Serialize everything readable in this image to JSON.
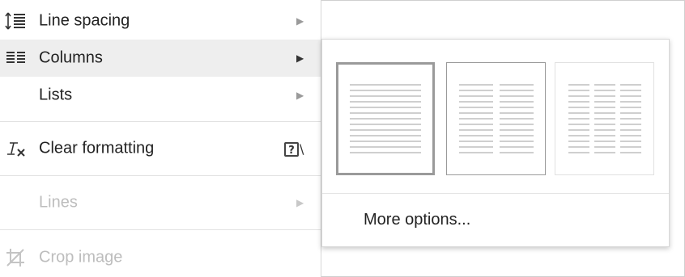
{
  "menu": {
    "line_spacing": {
      "label": "Line spacing",
      "icon": "line-spacing-icon"
    },
    "columns": {
      "label": "Columns",
      "icon": "columns-icon"
    },
    "lists": {
      "label": "Lists"
    },
    "clear_formatting": {
      "label": "Clear formatting",
      "icon": "clear-formatting-icon",
      "shortcut_key": "?",
      "shortcut_suffix": "\\"
    },
    "lines": {
      "label": "Lines",
      "disabled": true
    },
    "crop_image": {
      "label": "Crop image",
      "icon": "crop-icon",
      "disabled": true
    },
    "submenu_arrow": "▶"
  },
  "columns_submenu": {
    "options": [
      {
        "name": "one-column",
        "columns": 1,
        "selected": true
      },
      {
        "name": "two-columns",
        "columns": 2,
        "selected": false
      },
      {
        "name": "three-columns",
        "columns": 3,
        "selected": false
      }
    ],
    "more_options": "More options..."
  },
  "colors": {
    "highlight": "#eeeeee",
    "disabled_text": "#bdbdbd",
    "preview_line": "#cfcfcf",
    "selected_border": "#9a9a9a"
  }
}
